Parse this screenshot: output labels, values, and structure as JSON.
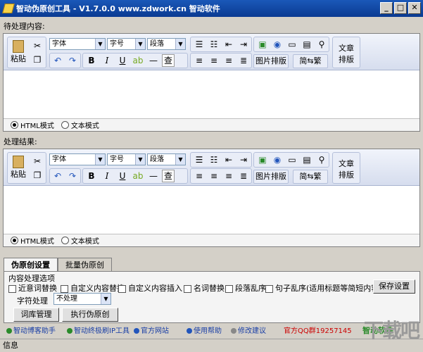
{
  "window": {
    "title": "智动伪原创工具  - V1.7.0.0  www.zdwork.cn 智动软件",
    "min": "_",
    "max": "□",
    "close": "✕"
  },
  "input_label": "待处理内容:",
  "output_label": "处理结果:",
  "toolbar": {
    "paste": "粘贴",
    "font": "字体",
    "size": "字号",
    "para": "段落",
    "image_layout": "图片排版",
    "convert": "简⇆繁",
    "article_layout_1": "文章",
    "article_layout_2": "排版",
    "find": "查",
    "bold": "B",
    "italic": "I",
    "underline": "U",
    "dash": "—"
  },
  "modes": {
    "html": "HTML模式",
    "text": "文本模式"
  },
  "tabs": [
    "伪原创设置",
    "批量伪原创"
  ],
  "options": {
    "section": "内容处理选项",
    "near_syn": "近意词替换",
    "custom_replace": "自定义内容替换",
    "custom_insert": "自定义内容插入",
    "noun_replace": "名词替换",
    "para_shuffle": "段落乱序",
    "sentence_shuffle": "句子乱序(适用标题等简短内容)",
    "save": "保存设置",
    "char_label": "字符处理",
    "char_value": "不处理",
    "lexicon": "词库管理",
    "run": "执行伪原创"
  },
  "links": {
    "blog": "智动博客助手",
    "adsl": "智动终极刷IP工具",
    "site": "官方网站",
    "help": "使用帮助",
    "suggest": "修改建议",
    "qq": "官方QQ群19257145",
    "brand": "智动软件"
  },
  "status": "信息",
  "watermark": "下载吧",
  "colors": {
    "title_bg": "#0a3a92",
    "link": "#1a3fa6",
    "qq": "#cc0000",
    "brand": "#2a8a2a"
  }
}
